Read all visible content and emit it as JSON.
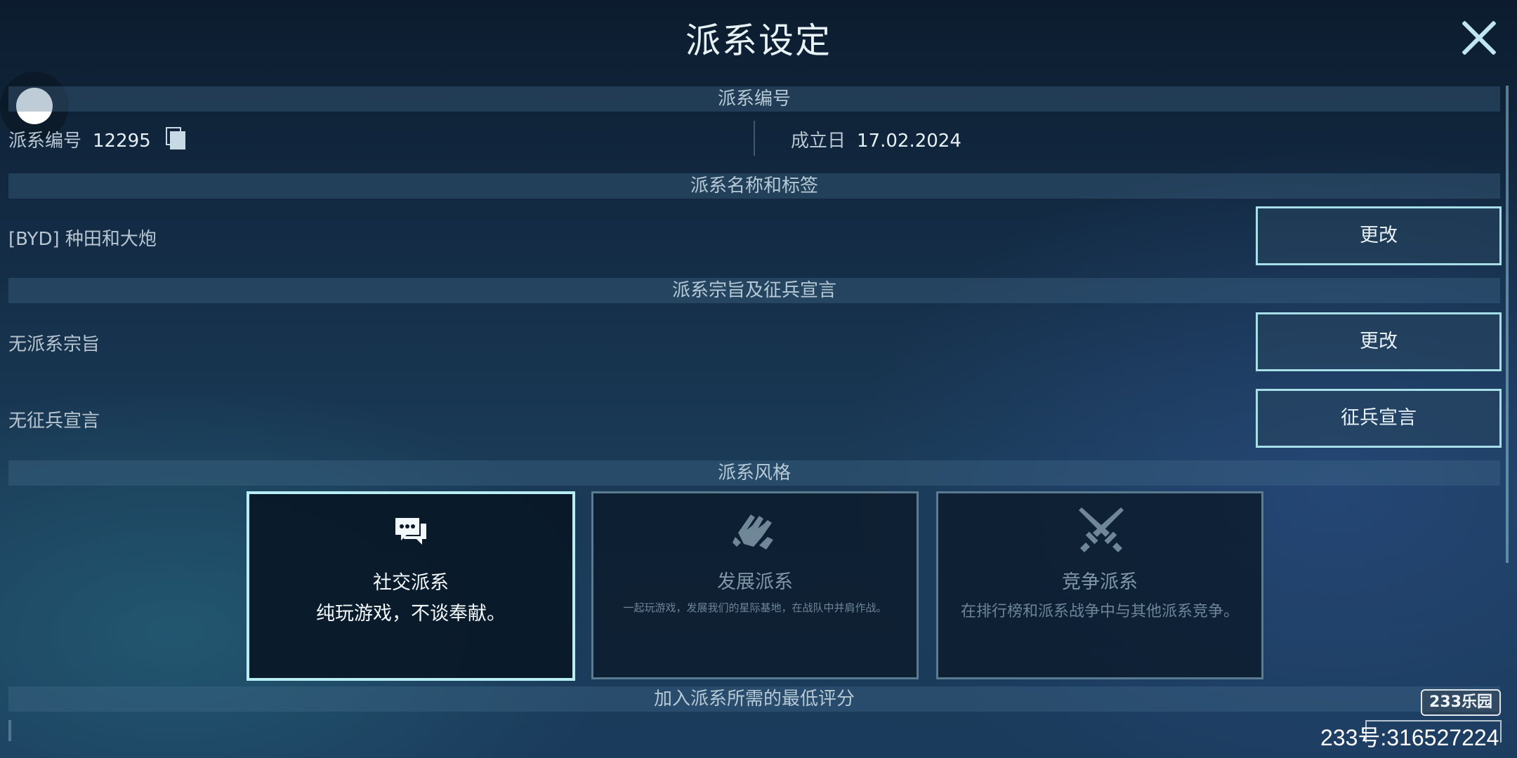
{
  "header": {
    "title": "派系设定",
    "close_icon": "close-icon"
  },
  "faction_id_section": {
    "title": "派系编号",
    "id_label": "派系编号",
    "id_value": "12295",
    "copy_icon": "copy-icon",
    "founded_label": "成立日",
    "founded_value": "17.02.2024"
  },
  "name_section": {
    "title": "派系名称和标签",
    "name_value": "[BYD] 种田和大炮",
    "change_label": "更改"
  },
  "purpose_section": {
    "title": "派系宗旨及征兵宣言",
    "purpose_value": "无派系宗旨",
    "purpose_change_label": "更改",
    "recruit_value": "无征兵宣言",
    "recruit_button_label": "征兵宣言"
  },
  "style_section": {
    "title": "派系风格",
    "cards": [
      {
        "name": "社交派系",
        "desc": "纯玩游戏，不谈奉献。",
        "icon": "chat-bubbles-icon",
        "selected": true
      },
      {
        "name": "发展派系",
        "desc": "一起玩游戏，发展我们的星际基地，在战队中并肩作战。",
        "icon": "handshake-icon",
        "selected": false
      },
      {
        "name": "竞争派系",
        "desc": "在排行榜和派系战争中与其他派系竞争。",
        "icon": "crossed-swords-icon",
        "selected": false
      }
    ]
  },
  "min_rating_section": {
    "title": "加入派系所需的最低评分"
  },
  "watermark": {
    "logo": "233乐园",
    "id_text": "233号:316527224"
  },
  "colors": {
    "accent": "#a6dfe8",
    "background": "#132b44"
  }
}
